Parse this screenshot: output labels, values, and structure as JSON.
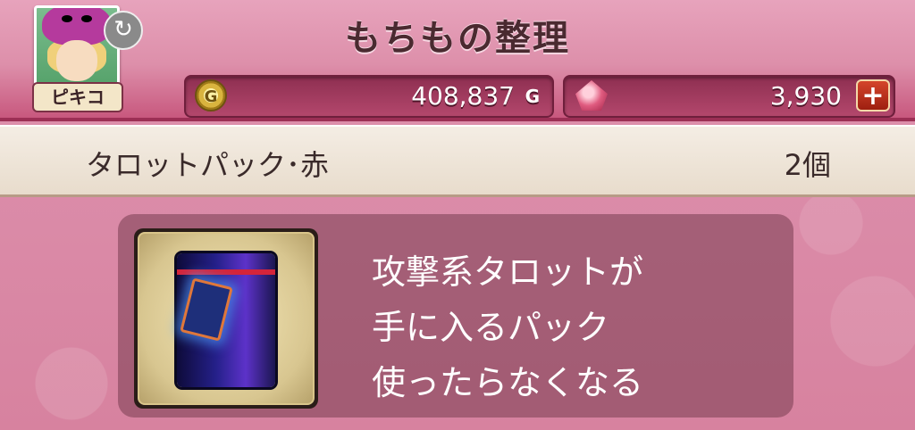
{
  "header": {
    "title": "もちもの整理",
    "player_name": "ピキコ",
    "gold": {
      "amount": "408,837",
      "unit": "G"
    },
    "gems": {
      "amount": "3,930"
    }
  },
  "item": {
    "name": "タロットパック･赤",
    "count": "2個",
    "description": [
      "攻撃系タロットが",
      "手に入るパック",
      "使ったらなくなる"
    ]
  },
  "icons": {
    "swap": "swap-icon",
    "coin": "gold-coin-icon",
    "gem": "gem-icon",
    "plus": "plus-icon",
    "item": "tarot-pack-icon"
  }
}
